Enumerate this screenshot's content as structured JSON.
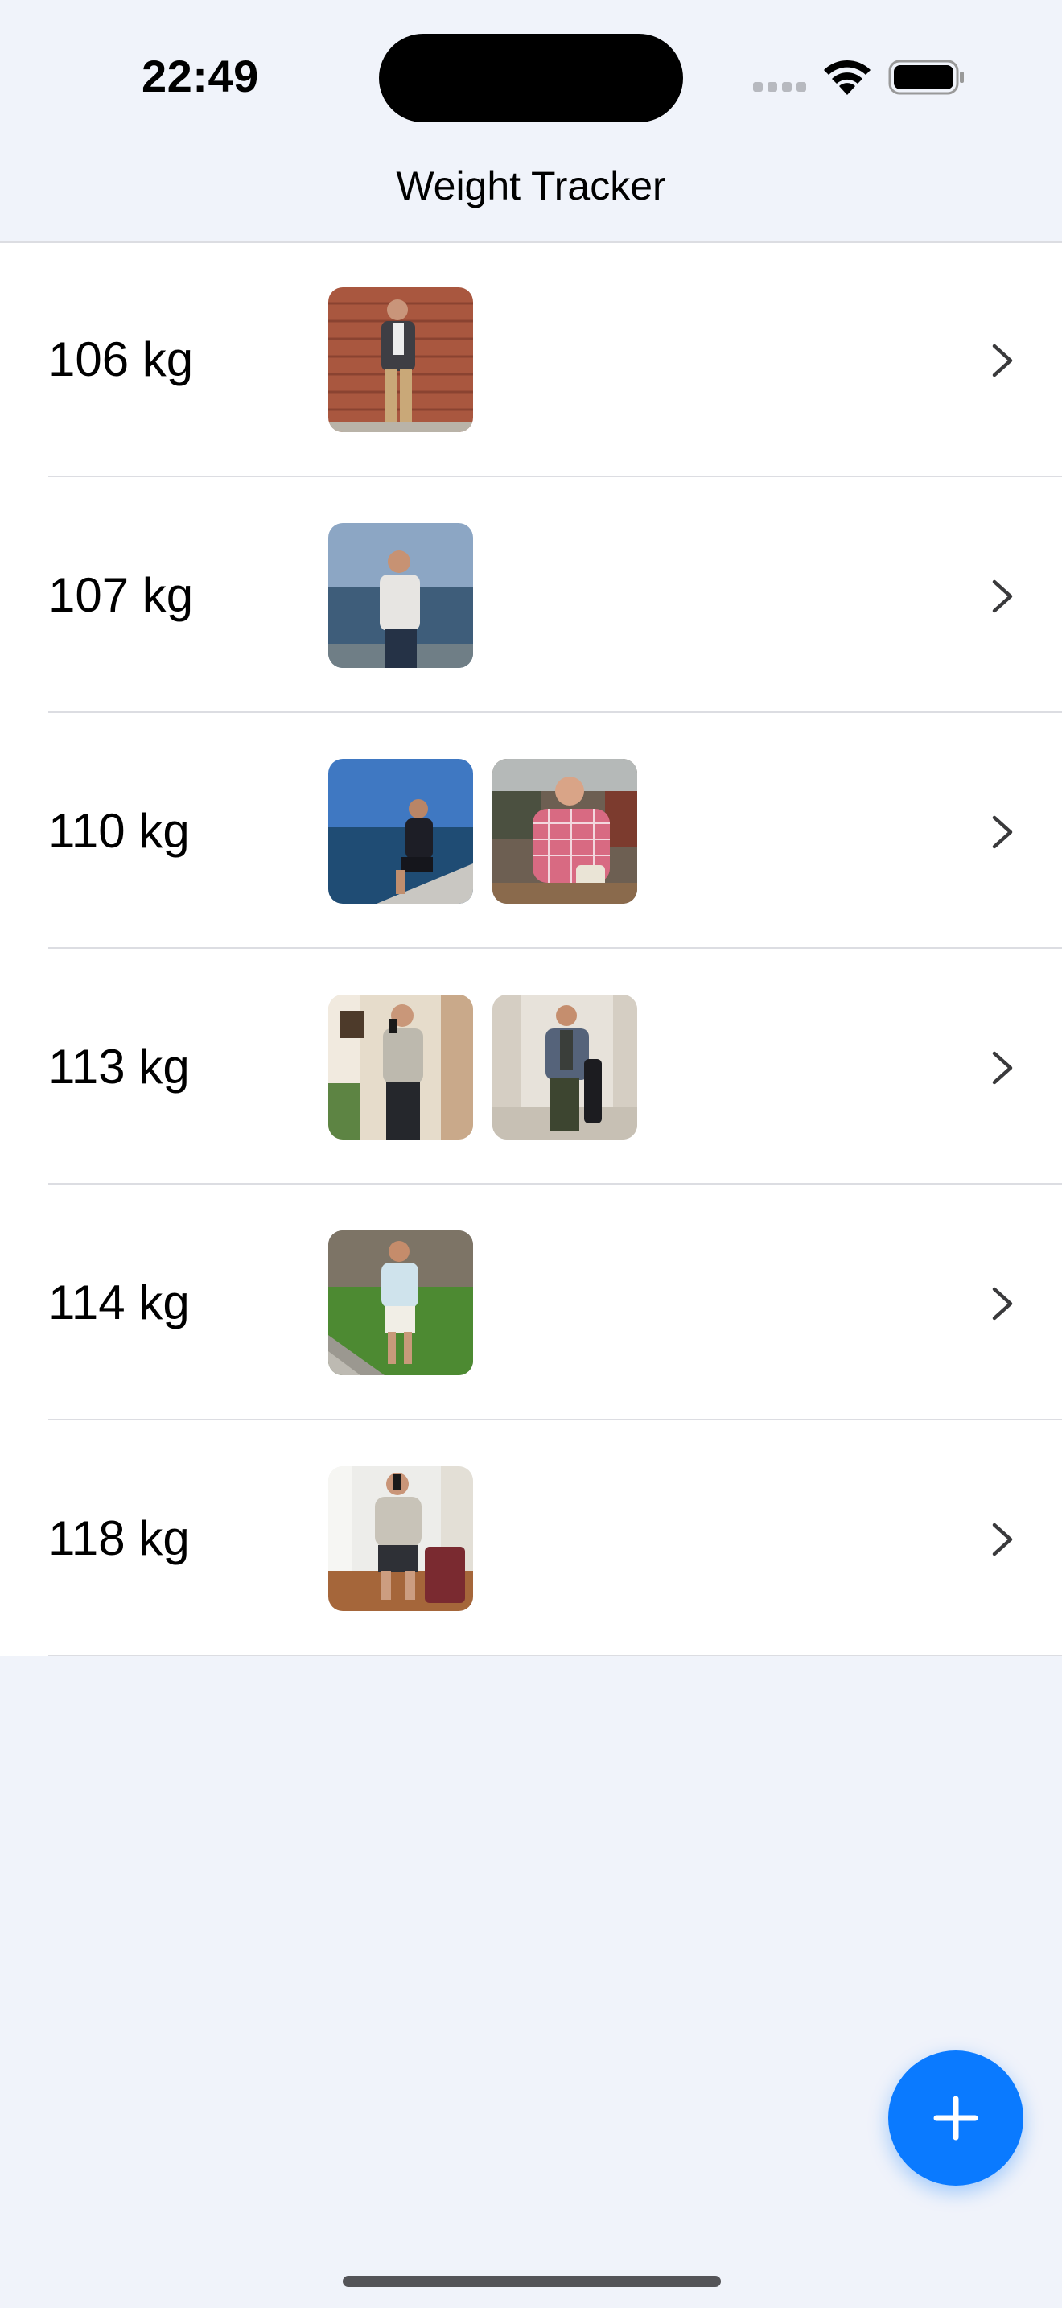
{
  "status_bar": {
    "time": "22:49"
  },
  "nav": {
    "title": "Weight Tracker"
  },
  "entries": [
    {
      "weight": "106 kg",
      "photos": [
        "brick-wall-blazer"
      ]
    },
    {
      "weight": "107 kg",
      "photos": [
        "seaside-phone-call"
      ]
    },
    {
      "weight": "110 kg",
      "photos": [
        "harbor-sitting",
        "restaurant-pink-shirt"
      ]
    },
    {
      "weight": "113 kg",
      "photos": [
        "mirror-selfie-hallway",
        "room-blazer"
      ]
    },
    {
      "weight": "114 kg",
      "photos": [
        "grass-wall-shorts"
      ]
    },
    {
      "weight": "118 kg",
      "photos": [
        "mirror-selfie-room"
      ]
    }
  ],
  "icons": {
    "chevron": "chevron-right-icon",
    "add": "plus-icon",
    "wifi": "wifi-icon",
    "battery": "battery-icon"
  },
  "colors": {
    "accent": "#0A7AFF",
    "background": "#F0F3FA",
    "separator": "#DCDDE2"
  }
}
